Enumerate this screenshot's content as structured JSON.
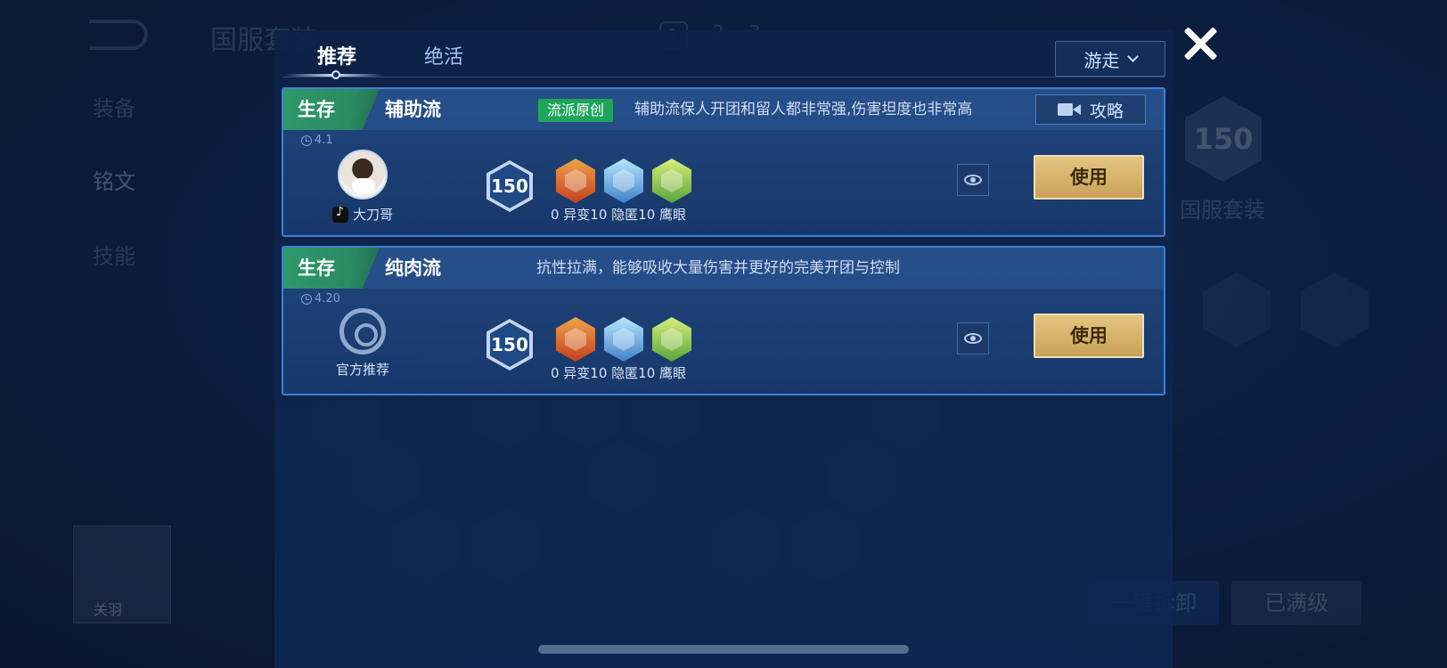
{
  "background": {
    "title": "国服套装",
    "sidebar": [
      "装备",
      "铭文",
      "技能"
    ],
    "level": "150",
    "set_name": "国服套装",
    "buttons": [
      "一键拆卸",
      "已满级"
    ],
    "hero": "关羽"
  },
  "tabs": [
    {
      "label": "推荐",
      "active": true
    },
    {
      "label": "绝活",
      "active": false
    }
  ],
  "role_select": {
    "value": "游走"
  },
  "cards": [
    {
      "category": "生存",
      "name": "辅助流",
      "badge": "流派原创",
      "description": "辅助流保人开团和留人都非常强,伤害坦度也非常高",
      "guide_label": "攻略",
      "version": "4.1",
      "author": "大刀哥",
      "level": "150",
      "runes": [
        "red",
        "blue",
        "green"
      ],
      "rune_labels": "0 异变10 隐匿10 鹰眼",
      "use_label": "使用"
    },
    {
      "category": "生存",
      "name": "纯肉流",
      "badge": "",
      "description": "抗性拉满，能够吸收大量伤害并更好的完美开团与控制",
      "guide_label": "",
      "version": "4.20",
      "author": "官方推荐",
      "level": "150",
      "runes": [
        "red",
        "blue",
        "green"
      ],
      "rune_labels": "0 异变10 隐匿10 鹰眼",
      "use_label": "使用"
    }
  ],
  "colors": {
    "accent_blue": "#3f80d0",
    "tag_green": "#2e9a6a",
    "use_gold": "#d7b46c"
  }
}
